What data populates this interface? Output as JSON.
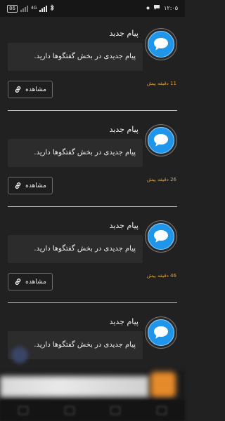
{
  "status_bar": {
    "time": "۱۲:۰۵",
    "battery": "86",
    "network": "4G"
  },
  "notifications": [
    {
      "title": "پیام جدید",
      "message": "پیام جدیدی در بخش گفتگوها دارید.",
      "time": "11 دقیقه پیش",
      "button_label": "مشاهده"
    },
    {
      "title": "پیام جدید",
      "message": "پیام جدیدی در بخش گفتگوها دارید.",
      "time": "26 دقیقه پیش",
      "button_label": "مشاهده"
    },
    {
      "title": "پیام جدید",
      "message": "پیام جدیدی در بخش گفتگوها دارید.",
      "time": "46 دقیقه پیش",
      "button_label": "مشاهده"
    },
    {
      "title": "پیام جدید",
      "message": "پیام جدیدی در بخش گفتگوها دارید."
    }
  ],
  "icons": {
    "avatar": "chat-bubble-icon",
    "button": "link-icon"
  },
  "colors": {
    "background": "#212121",
    "message_box": "#2c2c2c",
    "time_text": "#d9a13f",
    "avatar": "#1f96ea"
  }
}
